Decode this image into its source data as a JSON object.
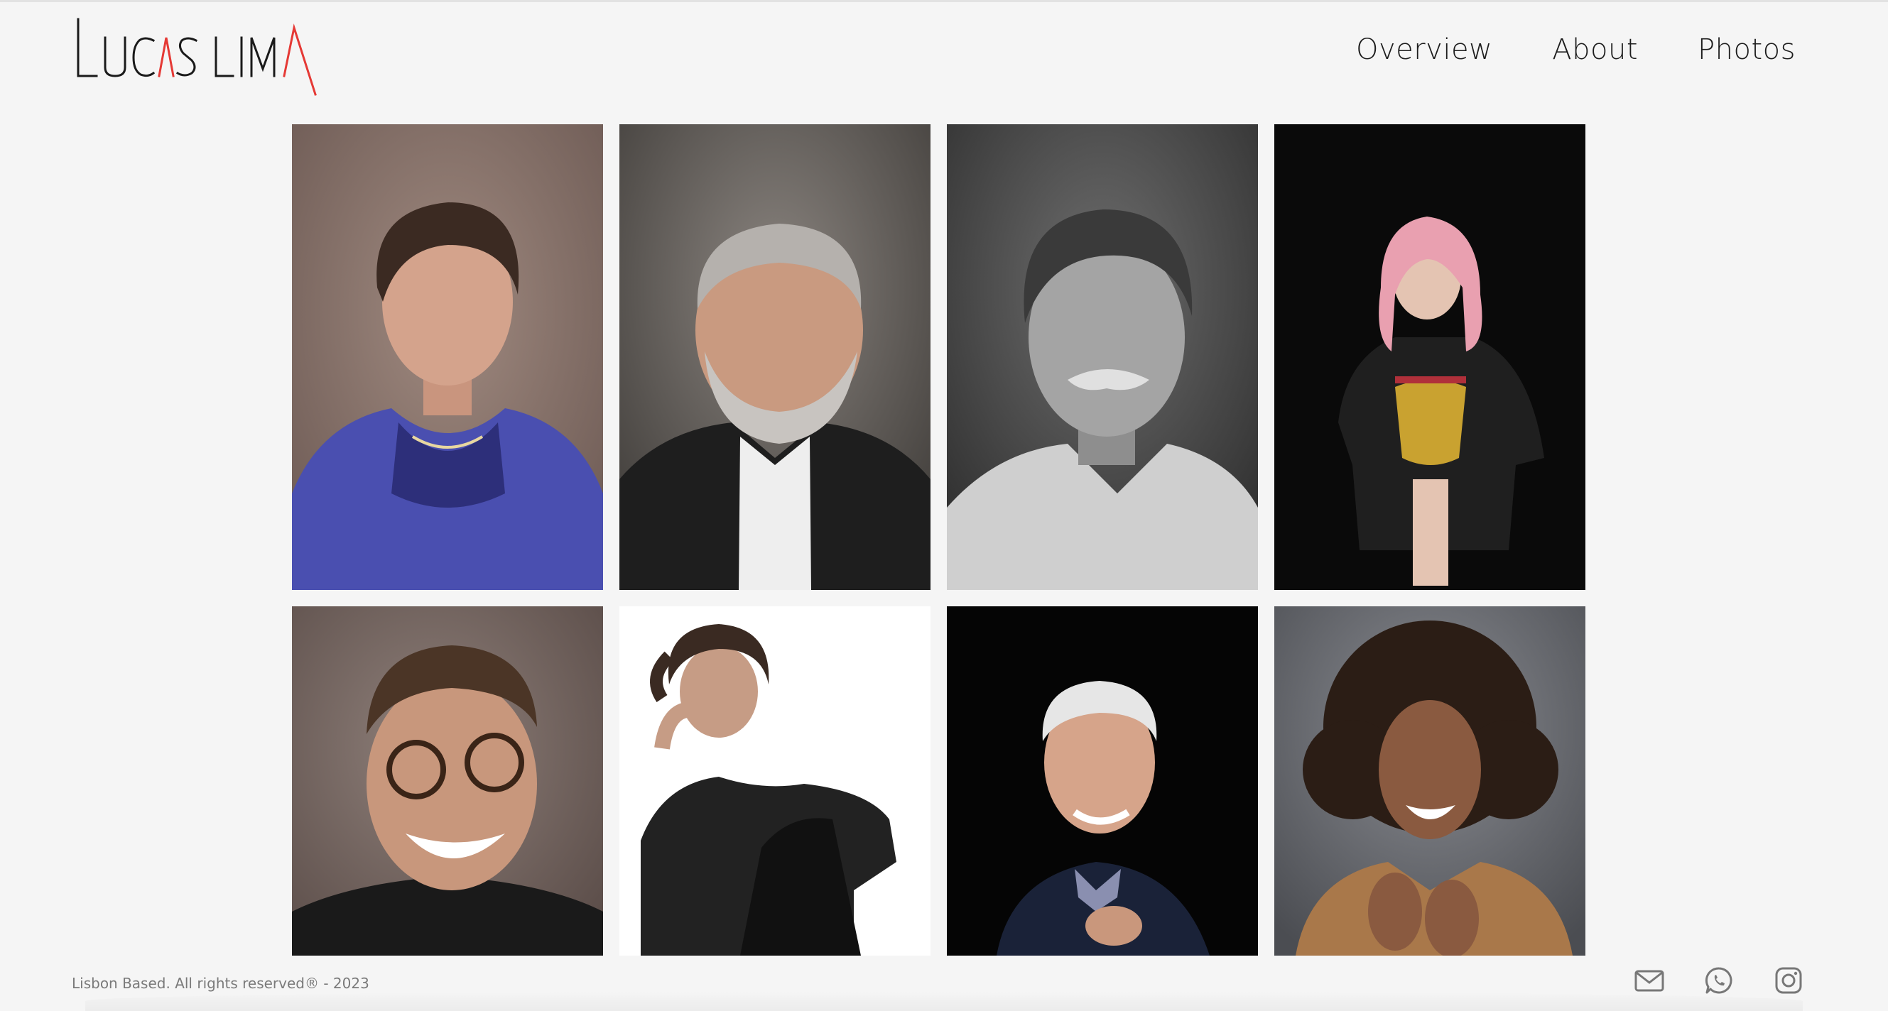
{
  "header": {
    "logo_text": "LUCAS LIMA",
    "nav": [
      {
        "label": "Overview"
      },
      {
        "label": "About"
      },
      {
        "label": "Photos"
      }
    ]
  },
  "gallery": {
    "photos": [
      {
        "subject": "woman-blue-jacket-portrait"
      },
      {
        "subject": "bearded-man-smiling-portrait"
      },
      {
        "subject": "elderly-man-eyes-closed-bw-portrait"
      },
      {
        "subject": "pink-hair-woman-band-tee-portrait"
      },
      {
        "subject": "man-glasses-laughing-portrait"
      },
      {
        "subject": "curly-hair-woman-chair-portrait"
      },
      {
        "subject": "white-hair-man-smiling-portrait"
      },
      {
        "subject": "curly-hair-woman-laughing-portrait"
      }
    ]
  },
  "footer": {
    "text": "Lisbon Based. All rights reserved® - 2023",
    "socials": [
      {
        "icon": "mail-icon"
      },
      {
        "icon": "whatsapp-icon"
      },
      {
        "icon": "instagram-icon"
      }
    ]
  },
  "colors": {
    "background": "#f5f5f5",
    "logo_accent": "#e53935",
    "text": "#1d1d1d",
    "footer_text": "#7a7a7a"
  }
}
